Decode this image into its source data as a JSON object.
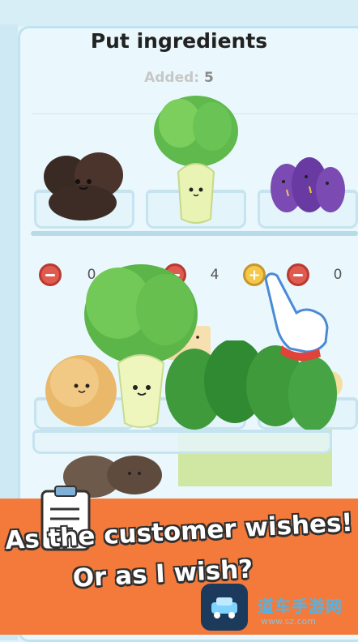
{
  "header": {
    "title": "Put ingredients",
    "added_label": "Added:",
    "added_count": "5"
  },
  "counters": [
    {
      "value": "0"
    },
    {
      "value": "4"
    },
    {
      "value": "0"
    }
  ],
  "banner": {
    "line1": "As the customer wishes!",
    "line2": "Or as I wish?"
  },
  "watermark": {
    "text": "道车手游网",
    "url": "www.sz.com"
  },
  "colors": {
    "banner": "#f37a3b",
    "minus": "#e05a4f",
    "plus": "#f4c84a",
    "fridge": "#eaf8fd"
  }
}
